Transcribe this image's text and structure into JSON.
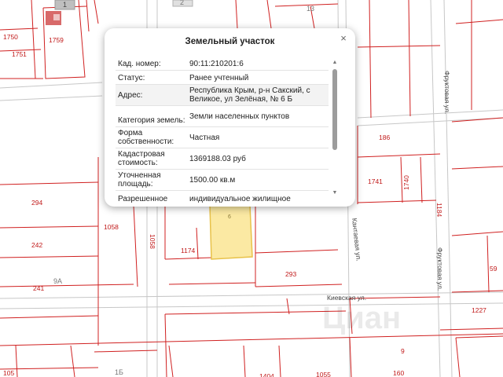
{
  "map": {
    "parcel_labels": [
      "1750",
      "1759",
      "1751",
      "2",
      "13",
      "186",
      "1741",
      "1740",
      "1184",
      "294",
      "1058",
      "1058",
      "242",
      "1174",
      "293",
      "241",
      "9А",
      "59",
      "1227",
      "9",
      "1Б",
      "1055",
      "160",
      "105",
      "1404"
    ],
    "highlighted_parcel_label": "6",
    "street_labels": [
      "Фруктовая ул.",
      "Фруктовая ул.",
      "Кантаевая ул.",
      "Киевская ул."
    ],
    "watermark": "Циан",
    "grey_tile_label": "1"
  },
  "popup": {
    "title": "Земельный участок",
    "close_symbol": "×",
    "rows": [
      {
        "key": "Кад. номер:",
        "value": "90:11:210201:6"
      },
      {
        "key": "Статус:",
        "value": "Ранее учтенный"
      },
      {
        "key": "Адрес:",
        "value": "Республика Крым, р-н Сакский, с Великое, ул Зелёная, № 6 Б"
      },
      {
        "key": "Категория земель:",
        "value": "Земли населенных пунктов"
      },
      {
        "key": "Форма собственности:",
        "value": "Частная"
      },
      {
        "key": "Кадастровая стоимость:",
        "value": "1369188.03 руб"
      },
      {
        "key": "Уточненная площадь:",
        "value": "1500.00 кв.м"
      },
      {
        "key": "Разрешенное",
        "value": "индивидуальное жилищное"
      }
    ],
    "scroll_up": "▲",
    "scroll_down": "▼"
  }
}
